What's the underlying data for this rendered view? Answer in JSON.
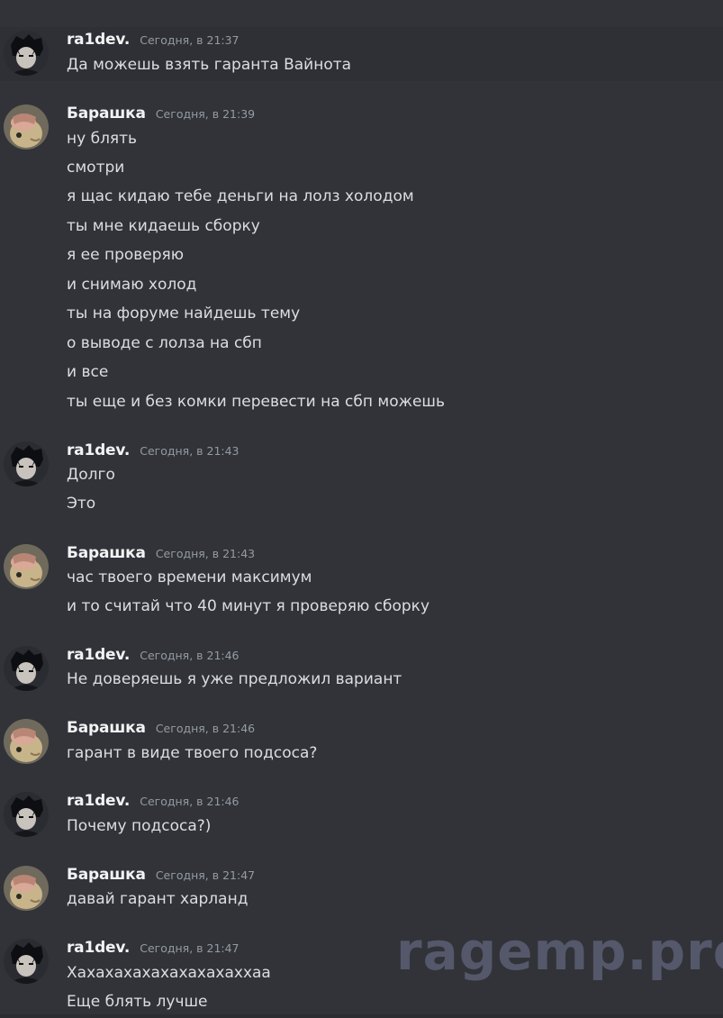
{
  "messages": [
    {
      "author": "ra1dev.",
      "timestamp": "Сегодня, в 21:37",
      "lines": [
        "Да можешь взять гаранта Вайнота"
      ]
    },
    {
      "author": "Барашка",
      "timestamp": "Сегодня, в 21:39",
      "lines": [
        "ну блять",
        "смотри",
        "я щас кидаю тебе деньги на лолз холодом",
        "ты мне кидаешь сборку",
        "я ее проверяю",
        "и снимаю холод",
        "ты на форуме найдешь тему",
        "о выводе с лолза на сбп",
        "и все",
        "ты еще и без комки перевести на сбп можешь"
      ]
    },
    {
      "author": "ra1dev.",
      "timestamp": "Сегодня, в 21:43",
      "lines": [
        "Долго",
        "Это"
      ]
    },
    {
      "author": "Барашка",
      "timestamp": "Сегодня, в 21:43",
      "lines": [
        "час твоего времени максимум",
        "и то считай что 40 минут я проверяю сборку"
      ]
    },
    {
      "author": "ra1dev.",
      "timestamp": "Сегодня, в 21:46",
      "lines": [
        "Не доверяешь я уже предложил вариант"
      ]
    },
    {
      "author": "Барашка",
      "timestamp": "Сегодня, в 21:46",
      "lines": [
        "гарант в виде твоего подсоса?"
      ]
    },
    {
      "author": "ra1dev.",
      "timestamp": "Сегодня, в 21:46",
      "lines": [
        "Почему подсоса?)"
      ]
    },
    {
      "author": "Барашка",
      "timestamp": "Сегодня, в 21:47",
      "lines": [
        "давай гарант харланд"
      ]
    },
    {
      "author": "ra1dev.",
      "timestamp": "Сегодня, в 21:47",
      "lines": [
        "Хахахахахахахахахаххаа",
        "Еще блять лучше"
      ]
    }
  ],
  "watermark": "ragemp.pro",
  "colors": {
    "background": "#313338",
    "author": "#f2f3f5",
    "text": "#dbdee1",
    "timestamp": "#949ba4"
  }
}
